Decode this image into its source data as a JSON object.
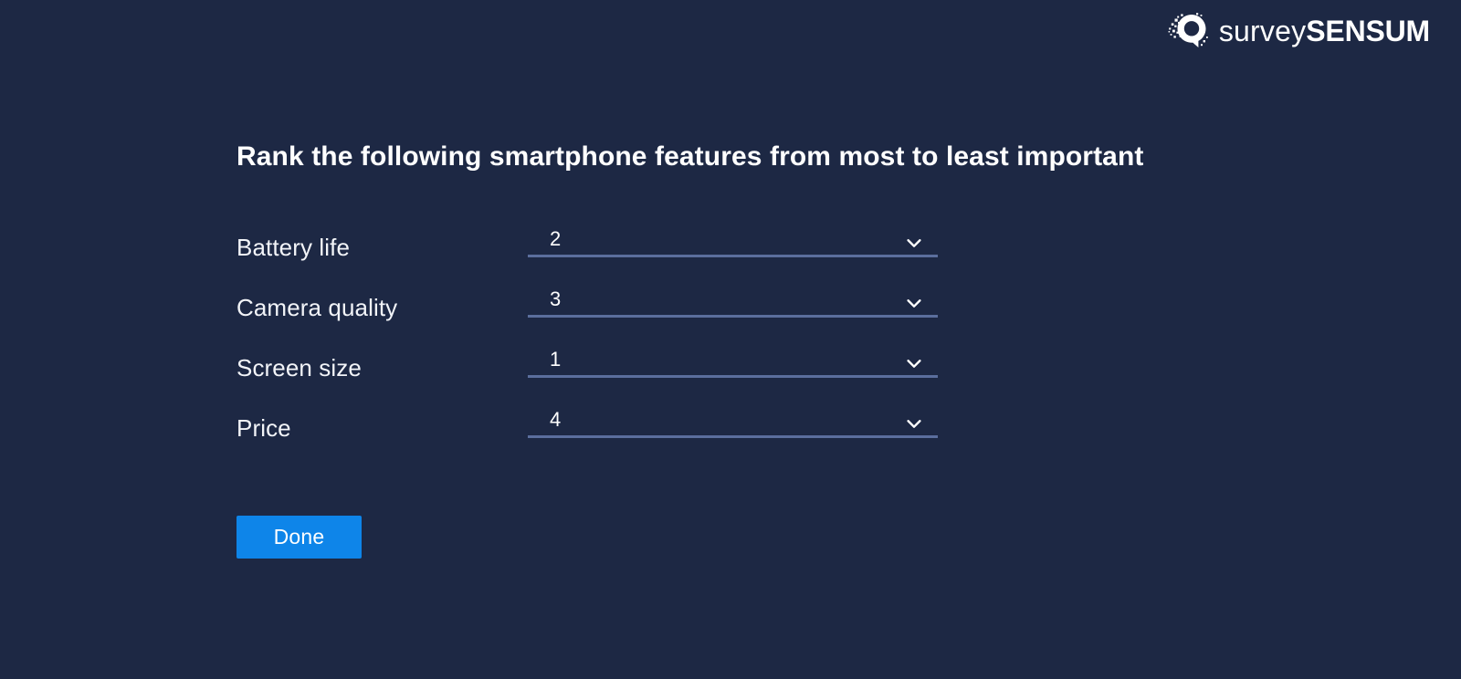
{
  "theme": {
    "background": "#1d2844",
    "text": "#ffffff",
    "underline": "#5b6e9d",
    "accent": "#0e85e9"
  },
  "brand": {
    "mark_icon": "surveysensum-pixel-bubble-icon",
    "name_light": "survey",
    "name_bold": "SENSUM"
  },
  "question": {
    "title": "Rank the following smartphone features from most to least important",
    "rows": [
      {
        "label": "Battery life",
        "value": "2",
        "chevron_icon": "chevron-down-icon"
      },
      {
        "label": "Camera quality",
        "value": "3",
        "chevron_icon": "chevron-down-icon"
      },
      {
        "label": "Screen size",
        "value": "1",
        "chevron_icon": "chevron-down-icon"
      },
      {
        "label": "Price",
        "value": "4",
        "chevron_icon": "chevron-down-icon"
      }
    ],
    "rank_options": [
      "1",
      "2",
      "3",
      "4"
    ]
  },
  "actions": {
    "done_label": "Done"
  }
}
